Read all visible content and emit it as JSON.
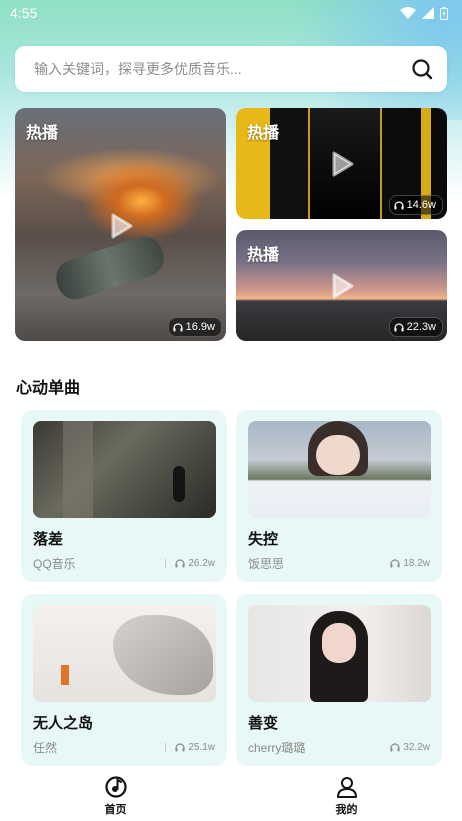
{
  "status_bar": {
    "time": "4:55"
  },
  "search": {
    "placeholder": "输入关键词，探寻更多优质音乐..."
  },
  "hot": [
    {
      "tag": "热播",
      "plays": "16.9w"
    },
    {
      "tag": "热播",
      "plays": "14.6w"
    },
    {
      "tag": "热播",
      "plays": "22.3w"
    }
  ],
  "section": {
    "title": "心动单曲"
  },
  "songs": [
    {
      "title": "落差",
      "artist": "QQ音乐",
      "plays": "26.2w"
    },
    {
      "title": "失控",
      "artist": "饭思思",
      "plays": "18.2w"
    },
    {
      "title": "无人之岛",
      "artist": "任然",
      "plays": "25.1w"
    },
    {
      "title": "善变",
      "artist": "cherry璐璐",
      "plays": "32.2w"
    }
  ],
  "tabbar": {
    "home_label": "首页",
    "mine_label": "我的"
  },
  "colors": {
    "card_bg": "#e8f8f6",
    "accent_gradient_top": "#8fe0c4"
  }
}
